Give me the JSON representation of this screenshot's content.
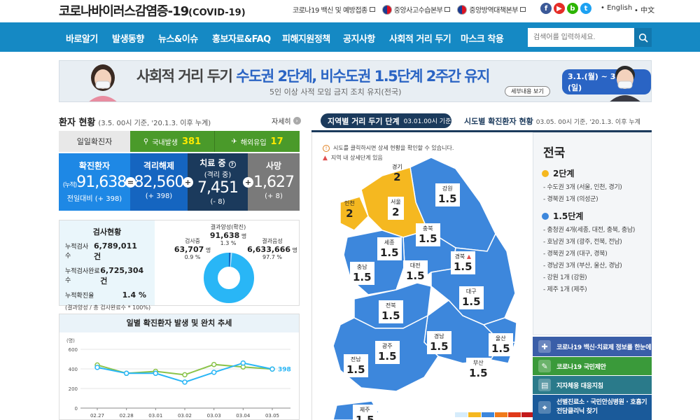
{
  "header": {
    "title": "코로나바이러스감염증-19",
    "title_sub": "(COVID-19)",
    "links": [
      {
        "label": "코로나19 백신 및 예방접종"
      },
      {
        "label": "중앙사고수습본부"
      },
      {
        "label": "중앙방역대책본부"
      }
    ],
    "sns": [
      {
        "icon": "facebook-icon",
        "glyph": "f",
        "color": "#3b5998"
      },
      {
        "icon": "youtube-icon",
        "glyph": "▶",
        "color": "#e52d27"
      },
      {
        "icon": "blog-icon",
        "glyph": "b",
        "color": "#2db400"
      },
      {
        "icon": "twitter-icon",
        "glyph": "t",
        "color": "#1da1f2"
      }
    ],
    "lang_en": "English",
    "lang_zh": "中文"
  },
  "nav": {
    "items": [
      "바로알기",
      "발생동향",
      "뉴스&이슈",
      "홍보자료&FAQ",
      "피해지원정책",
      "공지사항",
      "사회적 거리 두기",
      "마스크 착용"
    ],
    "search_placeholder": "검색어를 입력하세요."
  },
  "banner": {
    "headline_a": "사회적 거리 두기 ",
    "headline_b": "수도권 2단계, 비수도권 1.5단계 2주간 유지",
    "sub": "5인 이상 사적 모임 금지 조치 유지(전국)",
    "period": "3.1.(월) ~ 3.14.(일)",
    "more": "세부내용 보기"
  },
  "status": {
    "title": "환자 현황",
    "basis": "(3.5. 00시 기준, '20.1.3. 이후 누계)",
    "more": "자세히",
    "daily_label": "일일확진자",
    "domestic_label": "국내발생",
    "domestic_value": "381",
    "abroad_label": "해외유입",
    "abroad_value": "17",
    "confirmed_label": "확진환자",
    "confirmed_prefix": "(누적)",
    "confirmed_value": "91,638",
    "confirmed_delta": "전일대비 (+ 398)",
    "released_label": "격리해제",
    "released_value": "82,560",
    "released_delta": "(+ 398)",
    "treating_label": "치료 중",
    "treating_sub": "(격리 중)",
    "treating_value": "7,451",
    "treating_delta": "(- 8)",
    "death_label": "사망",
    "death_value": "1,627",
    "death_delta": "(+ 8)"
  },
  "tests": {
    "title": "검사현황",
    "rows": [
      {
        "label": "누적검사수",
        "value": "6,789,011 건"
      },
      {
        "label": "누적검사완료수",
        "value": "6,725,304 건"
      },
      {
        "label": "누적확진율",
        "value": "1.4 %"
      }
    ],
    "note": "(결과양성 / 총 검사완료수 * 100%)",
    "positive_label": "결과양성(확진)",
    "positive_value": "91,638",
    "positive_unit": "명",
    "positive_pct": "1.3 %",
    "testing_label": "검사중",
    "testing_value": "63,707",
    "testing_unit": "명",
    "testing_pct": "0.9 %",
    "negative_label": "결과음성",
    "negative_value": "6,633,666",
    "negative_unit": "명",
    "negative_pct": "97.7 %",
    "donut_colors": {
      "negative": "#29b6f6",
      "testing": "#b3e5fc",
      "positive": "#1565c0"
    }
  },
  "trend": {
    "title": "일별 확진환자 발생 및 완치 추세"
  },
  "chart_data": {
    "type": "line",
    "title": "일별 확진환자 발생 및 완치 추세",
    "ylabel": "(명)",
    "ylim": [
      0,
      600
    ],
    "yticks": [
      "0",
      "200",
      "400",
      "600"
    ],
    "categories": [
      "02.27",
      "02.28",
      "03.01",
      "03.02",
      "03.03",
      "03.04",
      "03.05"
    ],
    "series": [
      {
        "values": [
          440,
          355,
          375,
          340,
          445,
          420,
          398
        ],
        "color": "#8bc34a"
      },
      {
        "values": [
          415,
          355,
          355,
          265,
          365,
          460,
          398
        ],
        "color": "#29b6f6"
      }
    ],
    "end_label": "398"
  },
  "map": {
    "tab_active": "지역별 거리 두기 단계",
    "tab_active_basis": "03.01.00시 기준",
    "tab_other": "시도별 확진환자 현황",
    "tab_other_basis": "03.05. 00시 기준, '20.1.3. 이후 누계",
    "note1": "시도를 클릭하시면 상세 현황을 확인할 수 있습니다.",
    "note2": "지역 내 상세단계 있음",
    "colors": {
      "level2": "#f5b820",
      "level15": "#3d87dc"
    },
    "regions": [
      {
        "name": "경기",
        "level": "2"
      },
      {
        "name": "인천",
        "level": "2"
      },
      {
        "name": "서울",
        "level": "2"
      },
      {
        "name": "강원",
        "level": "1.5"
      },
      {
        "name": "충북",
        "level": "1.5"
      },
      {
        "name": "세종",
        "level": "1.5"
      },
      {
        "name": "경북",
        "level": "1.5"
      },
      {
        "name": "충남",
        "level": "1.5"
      },
      {
        "name": "대전",
        "level": "1.5"
      },
      {
        "name": "대구",
        "level": "1.5"
      },
      {
        "name": "전북",
        "level": "1.5"
      },
      {
        "name": "울산",
        "level": "1.5"
      },
      {
        "name": "경남",
        "level": "1.5"
      },
      {
        "name": "광주",
        "level": "1.5"
      },
      {
        "name": "전남",
        "level": "1.5"
      },
      {
        "name": "부산",
        "level": "1.5"
      },
      {
        "name": "제주",
        "level": "1.5"
      }
    ],
    "legend_colors": [
      "#d6ecfb",
      "#f5b820",
      "#3d87dc",
      "#f07a1a",
      "#e03a1a",
      "#c41a1a"
    ]
  },
  "summary": {
    "title": "전국",
    "level2_title": "2단계",
    "level2_items": [
      "- 수도권 3개 (서울, 인천, 경기)",
      "- 경북권 1개 (의성군)"
    ],
    "level15_title": "1.5단계",
    "level15_items": [
      "- 충청권 4개(세종, 대전, 충북, 충남)",
      "- 호남권 3개 (광주, 전북, 전남)",
      "- 경북권 2개 (대구, 경북)",
      "- 경남권 3개 (부산, 울산, 경남)",
      "- 강원 1개 (강원)",
      "- 제주 1개 (제주)"
    ]
  },
  "quick_links": [
    {
      "label": "코로나19 백신·치료제 정보를 한눈에",
      "color": "#3a5ea8",
      "icon": "syringe-icon",
      "glyph": "✚"
    },
    {
      "label": "코로나19 국민제안",
      "color": "#3a9a3a",
      "icon": "pencil-icon",
      "glyph": "✎"
    },
    {
      "label": "지자체용 대응지침",
      "color": "#2a7a8a",
      "icon": "book-icon",
      "glyph": "▤"
    },
    {
      "label": "선별진료소 · 국민안심병원 · 호흡기전담클리닉 찾기",
      "color": "#1a5a9a",
      "icon": "hospital-icon",
      "glyph": "⌖"
    }
  ]
}
